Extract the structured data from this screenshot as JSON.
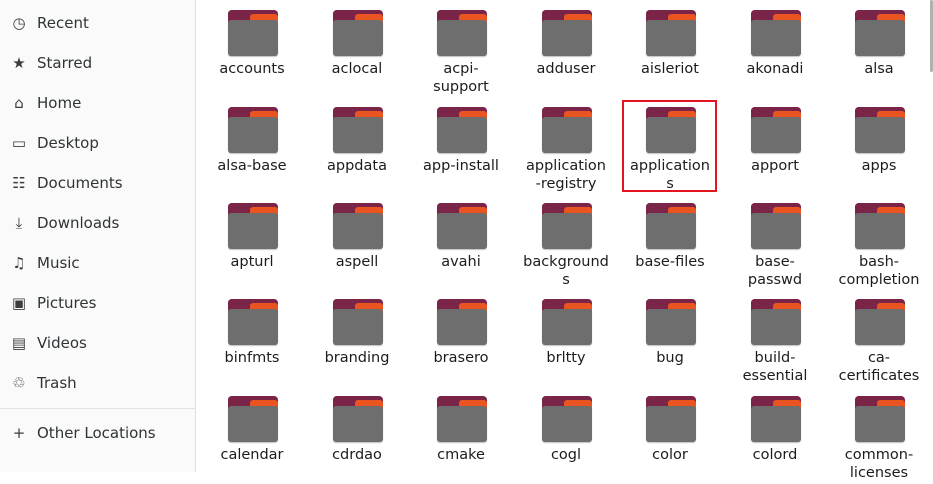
{
  "sidebar": {
    "items": [
      {
        "label": "Recent",
        "icon": "clock-icon"
      },
      {
        "label": "Starred",
        "icon": "star-icon"
      },
      {
        "label": "Home",
        "icon": "home-icon"
      },
      {
        "label": "Desktop",
        "icon": "desktop-icon"
      },
      {
        "label": "Documents",
        "icon": "documents-icon"
      },
      {
        "label": "Downloads",
        "icon": "download-icon"
      },
      {
        "label": "Music",
        "icon": "music-icon"
      },
      {
        "label": "Pictures",
        "icon": "pictures-icon"
      },
      {
        "label": "Videos",
        "icon": "videos-icon"
      },
      {
        "label": "Trash",
        "icon": "trash-icon"
      }
    ],
    "other_locations": {
      "label": "Other Locations",
      "icon": "plus-icon"
    }
  },
  "files": {
    "rows": [
      [
        "accounts",
        "aclocal",
        "acpi-\nsupport",
        "adduser",
        "aisleriot",
        "akonadi",
        "alsa"
      ],
      [
        "alsa-base",
        "appdata",
        "app-install",
        "application\n-registry",
        "application\ns",
        "apport",
        "apps"
      ],
      [
        "apturl",
        "aspell",
        "avahi",
        "background\ns",
        "base-files",
        "base-\npasswd",
        "bash-\ncompletion"
      ],
      [
        "binfmts",
        "branding",
        "brasero",
        "brltty",
        "bug",
        "build-\nessential",
        "ca-\ncertificates"
      ],
      [
        "calendar",
        "cdrdao",
        "cmake",
        "cogl",
        "color",
        "colord",
        "common-\nlicenses"
      ]
    ],
    "selected": "applications"
  },
  "colors": {
    "folder_back": "#7a2448",
    "folder_edge": "#e95420",
    "folder_front": "#6e6e6e",
    "highlight": "#e3151f"
  }
}
